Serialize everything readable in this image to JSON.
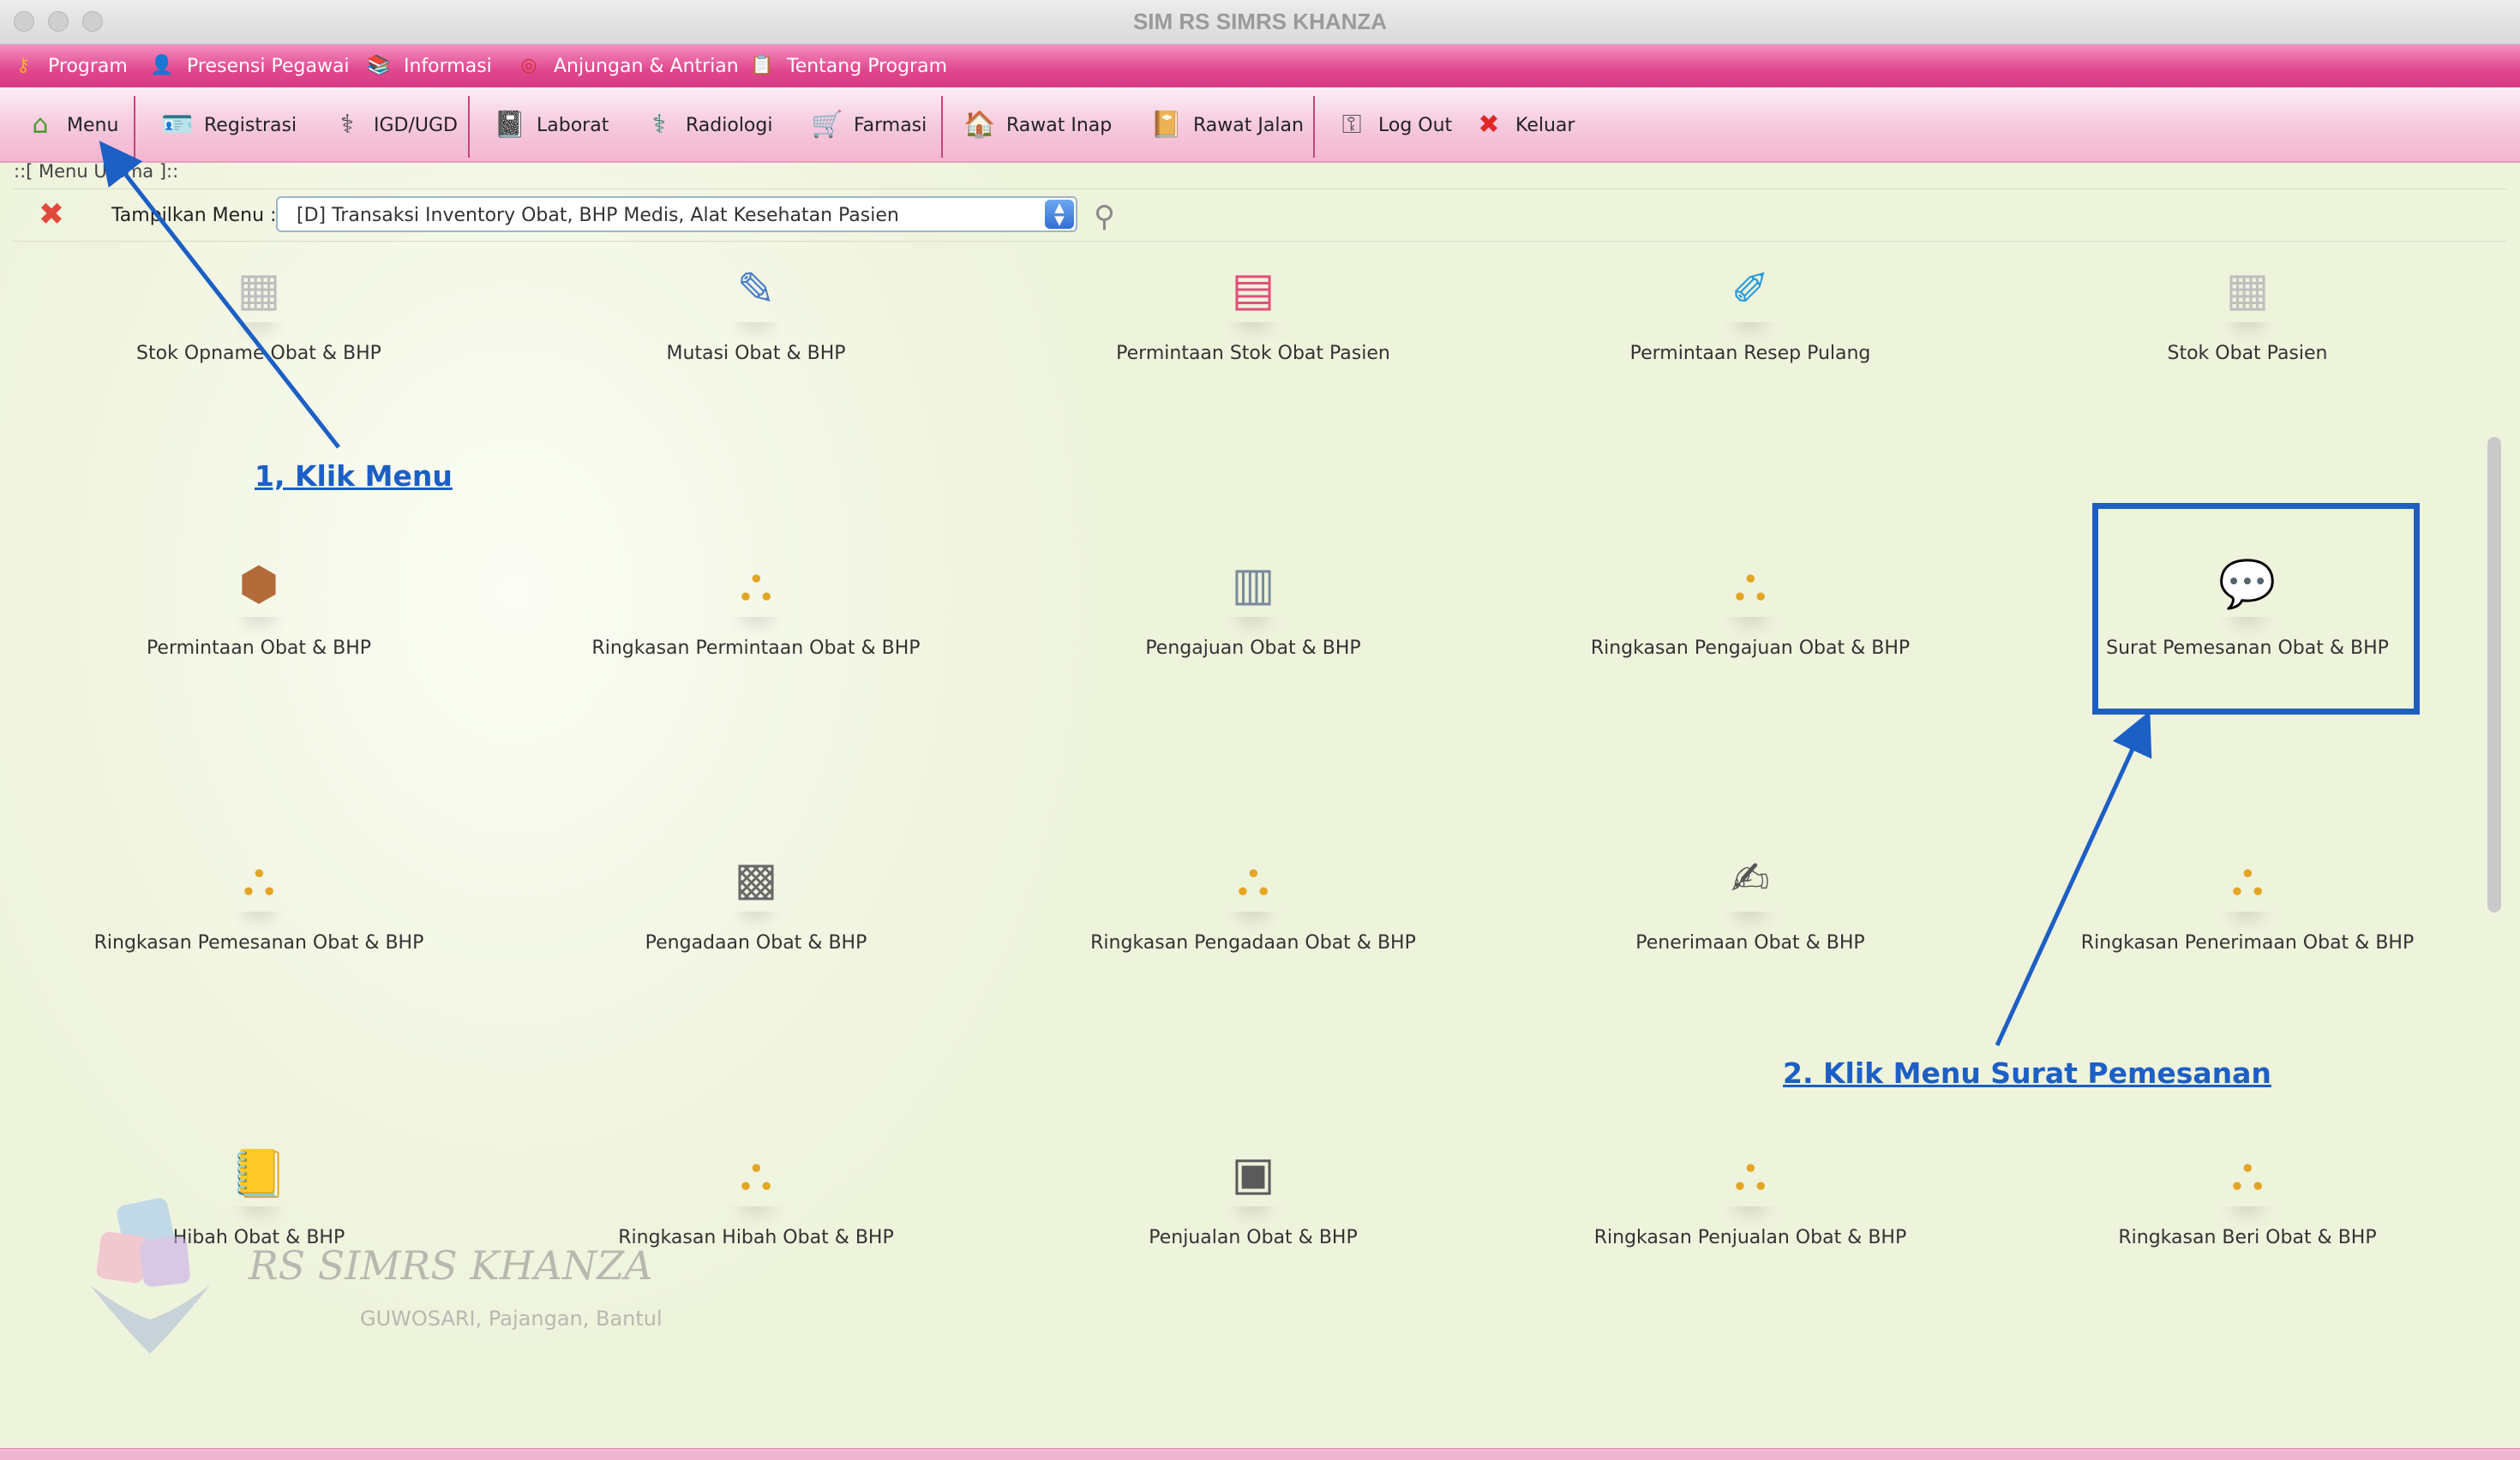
{
  "window": {
    "title": "SIM RS SIMRS KHANZA"
  },
  "menubar": {
    "items": [
      {
        "label": "Program",
        "icon": "key-icon"
      },
      {
        "label": "Presensi Pegawai",
        "icon": "person-icon"
      },
      {
        "label": "Informasi",
        "icon": "books-icon"
      },
      {
        "label": "Anjungan & Antrian",
        "icon": "lifebuoy-icon"
      },
      {
        "label": "Tentang Program",
        "icon": "clipboard-icon"
      }
    ]
  },
  "toolbar": {
    "items": [
      {
        "label": "Menu",
        "icon": "home-icon"
      },
      {
        "label": "Registrasi",
        "icon": "id-card-icon"
      },
      {
        "label": "IGD/UGD",
        "icon": "doctor-icon"
      },
      {
        "label": "Laborat",
        "icon": "lab-book-icon"
      },
      {
        "label": "Radiologi",
        "icon": "nurse-icon"
      },
      {
        "label": "Farmasi",
        "icon": "pharmacy-cart-icon"
      },
      {
        "label": "Rawat Inap",
        "icon": "house-icon"
      },
      {
        "label": "Rawat Jalan",
        "icon": "outpatient-book-icon"
      },
      {
        "label": "Log Out",
        "icon": "keys-icon"
      },
      {
        "label": "Keluar",
        "icon": "exit-x-icon"
      }
    ]
  },
  "panel": {
    "frame_label": "::[ Menu Utama ]::",
    "filter_label": "Tampilkan Menu :",
    "selected_menu": "[D] Transaksi Inventory Obat, BHP Medis, Alat Kesehatan Pasien"
  },
  "tiles": [
    {
      "label": "Stok Opname Obat & BHP",
      "icon": "boxes-icon"
    },
    {
      "label": "Mutasi Obat & BHP",
      "icon": "edit-document-icon"
    },
    {
      "label": "Permintaan Stok Obat Pasien",
      "icon": "calendar-sheet-icon"
    },
    {
      "label": "Permintaan Resep Pulang",
      "icon": "pencil-note-icon"
    },
    {
      "label": "Stok Obat Pasien",
      "icon": "boxes-icon"
    },
    {
      "label": "Permintaan Obat & BHP",
      "icon": "package-icon"
    },
    {
      "label": "Ringkasan Permintaan Obat & BHP",
      "icon": "org-chart-icon"
    },
    {
      "label": "Pengajuan Obat & BHP",
      "icon": "spreadsheet-edit-icon"
    },
    {
      "label": "Ringkasan Pengajuan Obat & BHP",
      "icon": "org-chart-icon"
    },
    {
      "label": "Surat Pemesanan Obat & BHP",
      "icon": "speech-chat-icon"
    },
    {
      "label": "Ringkasan Pemesanan Obat & BHP",
      "icon": "org-chart-icon"
    },
    {
      "label": "Pengadaan Obat & BHP",
      "icon": "calculator-icon"
    },
    {
      "label": "Ringkasan Pengadaan Obat & BHP",
      "icon": "org-chart-icon"
    },
    {
      "label": "Penerimaan Obat & BHP",
      "icon": "pen-paper-icon"
    },
    {
      "label": "Ringkasan Penerimaan Obat & BHP",
      "icon": "org-chart-icon"
    },
    {
      "label": "Hibah Obat & BHP",
      "icon": "address-book-icon"
    },
    {
      "label": "Ringkasan Hibah Obat & BHP",
      "icon": "org-chart-icon"
    },
    {
      "label": "Penjualan Obat & BHP",
      "icon": "cash-register-icon"
    },
    {
      "label": "Ringkasan Penjualan Obat & BHP",
      "icon": "org-chart-icon"
    },
    {
      "label": "Ringkasan Beri Obat & BHP",
      "icon": "org-chart-icon"
    }
  ],
  "watermark": {
    "name": "RS SIMRS KHANZA",
    "address": "GUWOSARI, Pajangan, Bantul"
  },
  "annotations": {
    "step1": "1, Klik Menu",
    "step2": "2. Klik Menu Surat Pemesanan",
    "color": "#1c5fc5"
  },
  "colors": {
    "menubar": "#e0478e",
    "toolbar": "#f6c8dd",
    "highlight": "#1f5fbf"
  }
}
